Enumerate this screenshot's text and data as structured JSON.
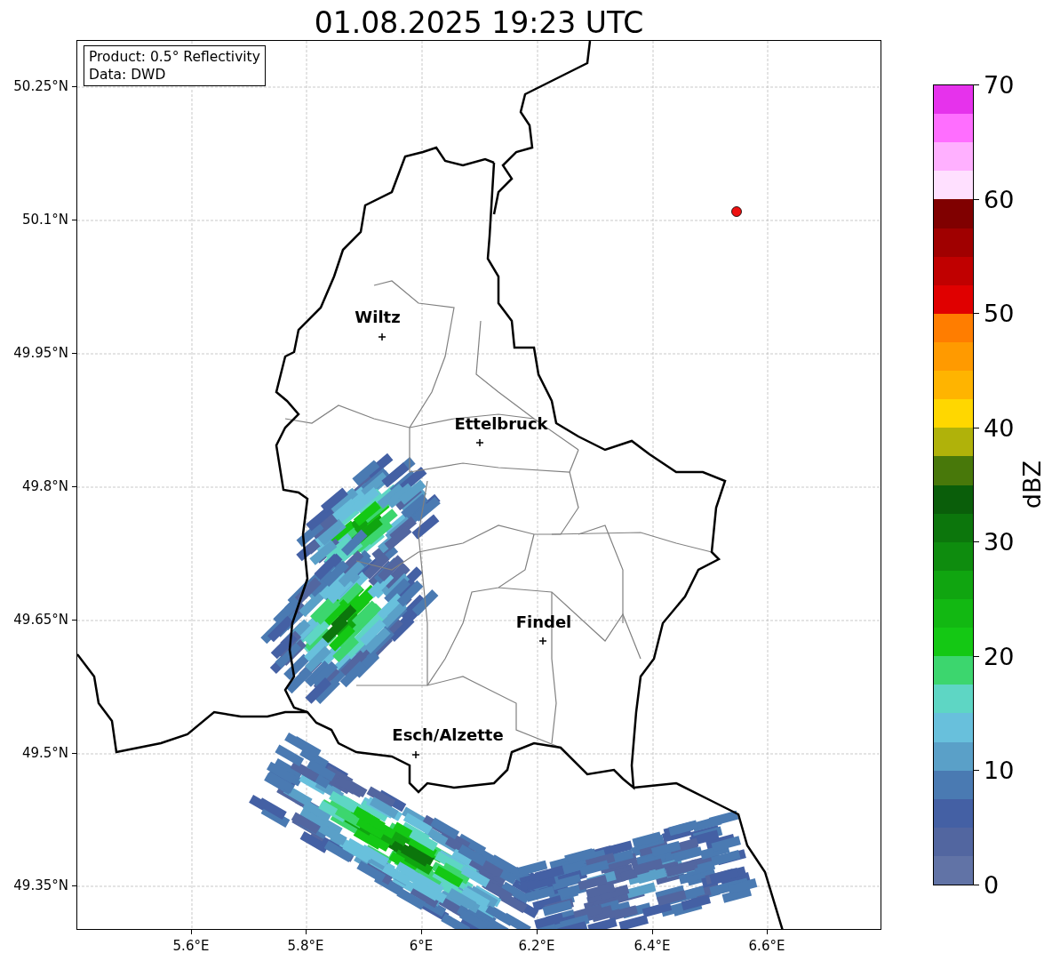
{
  "title": "01.08.2025 19:23 UTC",
  "info_box": [
    "Product: 0.5° Reflectivity",
    "Data: DWD"
  ],
  "y_ticks": [
    "50.25°N",
    "50.1°N",
    "49.95°N",
    "49.8°N",
    "49.65°N",
    "49.5°N",
    "49.35°N"
  ],
  "x_ticks": [
    "5.6°E",
    "5.8°E",
    "6°E",
    "6.2°E",
    "6.4°E",
    "6.6°E"
  ],
  "cities": [
    {
      "name": "Wiltz"
    },
    {
      "name": "Ettelbruck"
    },
    {
      "name": "Findel"
    },
    {
      "name": "Esch/Alzette"
    }
  ],
  "station_marker": {
    "color": "#ee1111"
  },
  "colorbar": {
    "label": "dBZ",
    "ticks": [
      "70",
      "60",
      "50",
      "40",
      "30",
      "20",
      "10",
      "0"
    ],
    "segments": [
      {
        "color": "#e632ec"
      },
      {
        "color": "#ff6eff"
      },
      {
        "color": "#ffb0ff"
      },
      {
        "color": "#ffe0ff"
      },
      {
        "color": "#800000"
      },
      {
        "color": "#a00000"
      },
      {
        "color": "#c00000"
      },
      {
        "color": "#e00000"
      },
      {
        "color": "#ff7d00"
      },
      {
        "color": "#ff9a00"
      },
      {
        "color": "#ffb400"
      },
      {
        "color": "#ffd700"
      },
      {
        "color": "#b0b20a"
      },
      {
        "color": "#48780a"
      },
      {
        "color": "#0a5e0a"
      },
      {
        "color": "#0c760c"
      },
      {
        "color": "#0e8c0e"
      },
      {
        "color": "#10a510"
      },
      {
        "color": "#12b812"
      },
      {
        "color": "#14c814"
      },
      {
        "color": "#3cd66e"
      },
      {
        "color": "#5ed6c4"
      },
      {
        "color": "#68c0dc"
      },
      {
        "color": "#5aa0c8"
      },
      {
        "color": "#4a7ab2"
      },
      {
        "color": "#4460a4"
      },
      {
        "color": "#5266a0"
      },
      {
        "color": "#6173a6"
      }
    ]
  }
}
